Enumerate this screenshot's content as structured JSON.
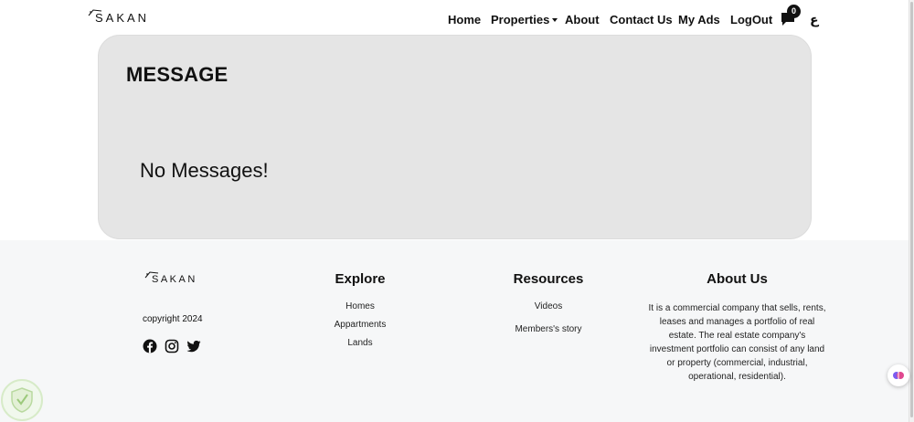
{
  "brand": {
    "logo_text": "SAKAN"
  },
  "nav": {
    "home": "Home",
    "properties": "Properties",
    "about": "About",
    "contact": "Contact Us",
    "my_ads": "My Ads",
    "logout": "LogOut",
    "messages_count": "0",
    "language_toggle": "ع"
  },
  "messages": {
    "title": "MESSAGE",
    "empty_text": "No Messages!"
  },
  "footer": {
    "brand_text": "SAKAN",
    "copyright": "copyright 2024",
    "social_icons": [
      "facebook-icon",
      "instagram-icon",
      "twitter-icon"
    ],
    "explore": {
      "heading": "Explore",
      "links": [
        "Homes",
        "Appartments",
        "Lands"
      ]
    },
    "resources": {
      "heading": "Resources",
      "links": [
        "Videos",
        "Members's story"
      ]
    },
    "about": {
      "heading": "About Us",
      "lines": [
        "It is a commercial company that sells, rents,",
        "leases and manages a portfolio of real",
        "estate. The real estate company's",
        "investment portfolio can consist of any land",
        "or property (commercial, industrial,",
        "operational, residential)."
      ]
    }
  },
  "colors": {
    "card_bg": "#e5e5e5",
    "footer_bg": "#f6f7f8",
    "text": "#111111",
    "badge_bg": "#111111"
  }
}
